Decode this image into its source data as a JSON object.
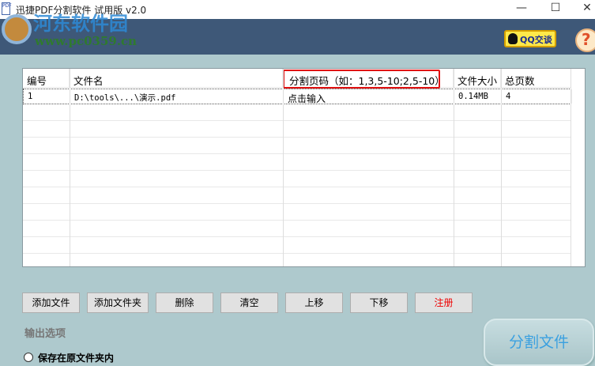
{
  "window": {
    "title": "迅捷PDF分割软件 试用版 v2.0",
    "minimize": "—",
    "maximize": "☐",
    "close": "✕"
  },
  "watermark": {
    "name": "河东软件园",
    "url": "www.pc0359.cn"
  },
  "banner": {
    "qq_label": "QQ交谈",
    "help": "?"
  },
  "table": {
    "columns": [
      "编号",
      "文件名",
      "分割页码（如：1,3,5-10;2,5-10）",
      "文件大小",
      "总页数"
    ],
    "rows": [
      [
        "1",
        "D:\\tools\\...\\演示.pdf",
        "点击输入",
        "0.14MB",
        "4"
      ]
    ]
  },
  "buttons": {
    "add_file": "添加文件",
    "add_folder": "添加文件夹",
    "delete": "删除",
    "clear": "清空",
    "move_up": "上移",
    "move_down": "下移",
    "register": "注册"
  },
  "output": {
    "section": "输出选项",
    "option_original": "保存在原文件夹内"
  },
  "split_button": "分割文件"
}
